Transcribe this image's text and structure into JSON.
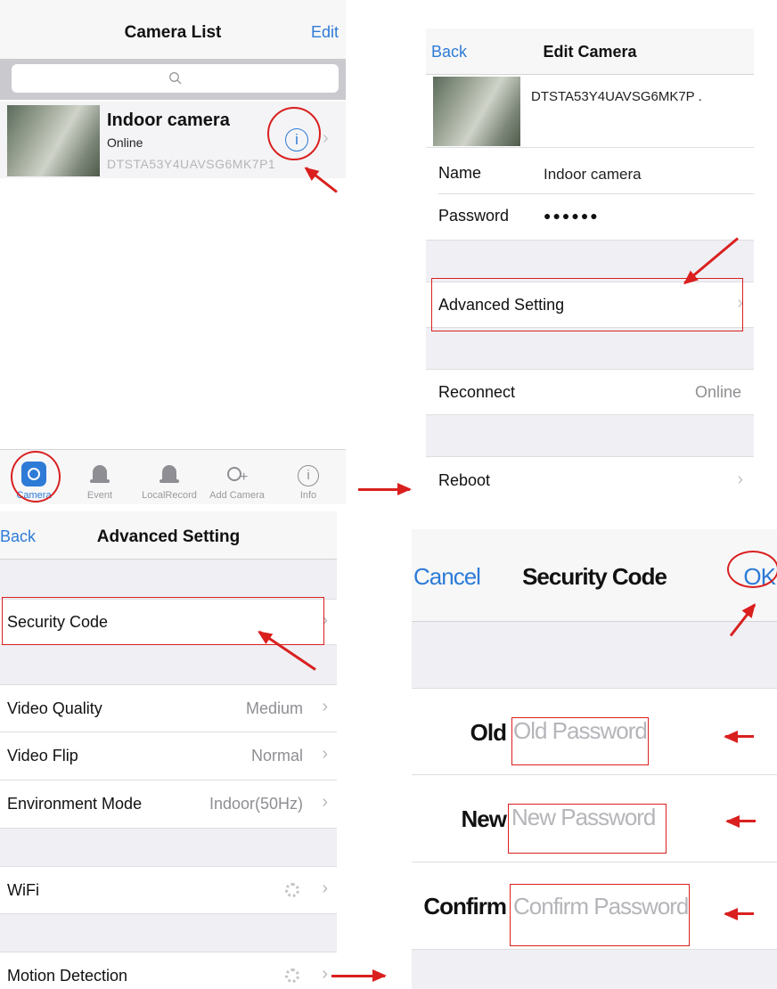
{
  "panel1": {
    "title": "Camera List",
    "edit": "Edit",
    "camera": {
      "name": "Indoor camera",
      "status": "Online",
      "id": "DTSTA53Y4UAVSG6MK7P1"
    },
    "tabs": [
      {
        "label": "Camera",
        "icon": "camera-icon"
      },
      {
        "label": "Event",
        "icon": "bell-icon"
      },
      {
        "label": "LocalRecord",
        "icon": "bell-icon"
      },
      {
        "label": "Add Camera",
        "icon": "add-camera-icon"
      },
      {
        "label": "Info",
        "icon": "info-icon"
      }
    ],
    "accent": "#2d7bd6"
  },
  "panel2": {
    "back": "Back",
    "title": "Edit Camera",
    "camera_id": "DTSTA53Y4UAVSG6MK7P .",
    "name_label": "Name",
    "name_value": "Indoor camera",
    "password_label": "Password",
    "password_value": "●●●●●●",
    "advanced": "Advanced Setting",
    "reconnect": "Reconnect",
    "reconnect_status": "Online",
    "reboot": "Reboot"
  },
  "panel3": {
    "back": "Back",
    "title": "Advanced Setting",
    "security": "Security Code",
    "video_quality": {
      "label": "Video Quality",
      "value": "Medium"
    },
    "video_flip": {
      "label": "Video Flip",
      "value": "Normal"
    },
    "environment": {
      "label": "Environment Mode",
      "value": "Indoor(50Hz)"
    },
    "wifi": "WiFi",
    "motion": "Motion Detection"
  },
  "panel4": {
    "cancel": "Cancel",
    "title": "Security Code",
    "ok": "OK",
    "old": {
      "label": "Old",
      "placeholder": "Old Password"
    },
    "new": {
      "label": "New",
      "placeholder": "New Password"
    },
    "confirm": {
      "label": "Confirm",
      "placeholder": "Confirm Password"
    }
  },
  "annotation_color": "#d9201f"
}
